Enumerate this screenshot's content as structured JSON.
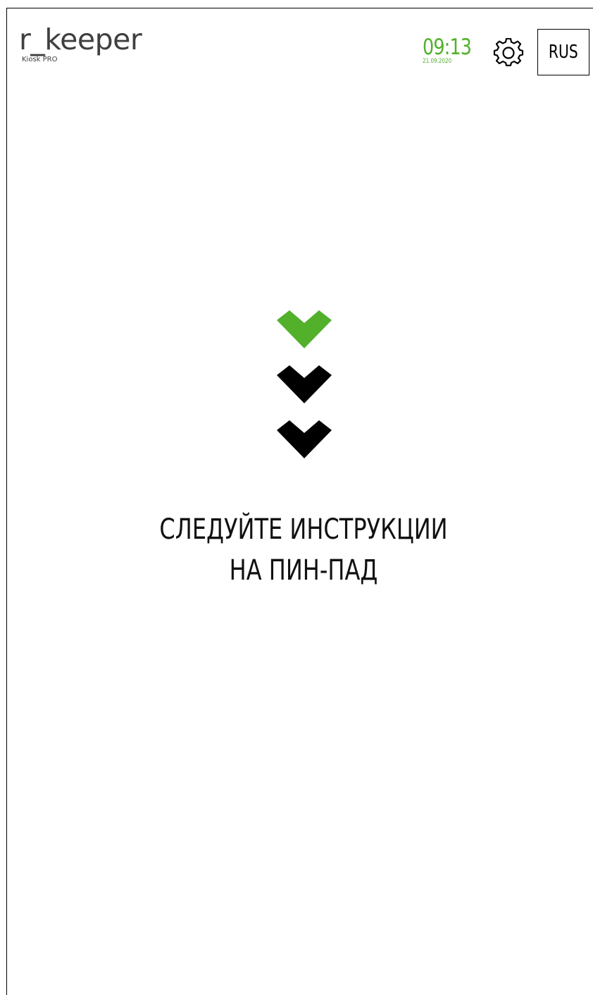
{
  "header": {
    "logo_text": "r_keeper",
    "logo_subtitle": "Kiosk PRO",
    "time": "09:13",
    "date": "21.09.2020",
    "settings_icon": "gear-icon",
    "language_label": "RUS"
  },
  "main": {
    "chevron_icons": [
      "chevron-down-icon",
      "chevron-down-icon",
      "chevron-down-icon"
    ],
    "message_line1": "СЛЕДУЙТЕ ИНСТРУКЦИИ",
    "message_line2": "НА ПИН-ПАД"
  },
  "colors": {
    "accent": "#52b02b",
    "text": "#111111",
    "logo": "#3f3f3f"
  }
}
